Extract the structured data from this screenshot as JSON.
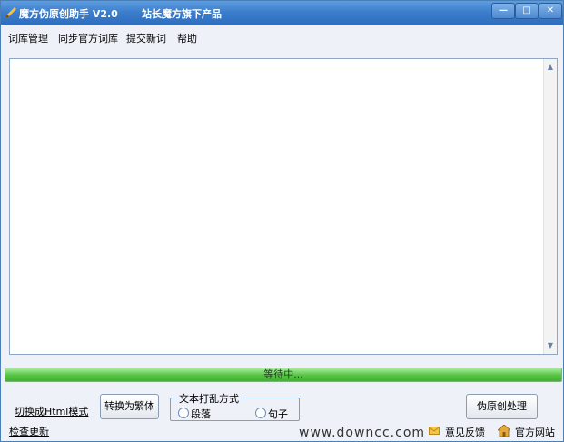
{
  "window": {
    "title": "魔方伪原创助手  V2.0",
    "subtitle": "站长魔方旗下产品",
    "controls": {
      "minimize": "—",
      "maximize": "□",
      "close": "✕"
    }
  },
  "menu": [
    "词库管理",
    "同步官方词库",
    "提交新词",
    "帮助"
  ],
  "editor": {
    "content": ""
  },
  "progress": {
    "label": "等待中...",
    "value": 1.0,
    "fill_color": "#4cc43a"
  },
  "bottom": {
    "switch_html_link": "切换成Html模式",
    "check_update_link": "检查更新",
    "convert_button": "转换为繁体",
    "scramble_group": {
      "legend": "文本打乱方式",
      "options": [
        "段落",
        "句子"
      ]
    },
    "process_button": "伪原创处理",
    "watermark": "www.downcc.com",
    "feedback_link": "意见反馈",
    "official_link": "官方网站"
  },
  "icons": {
    "app": "pencil-icon",
    "mail": "envelope-icon",
    "home": "home-icon"
  }
}
